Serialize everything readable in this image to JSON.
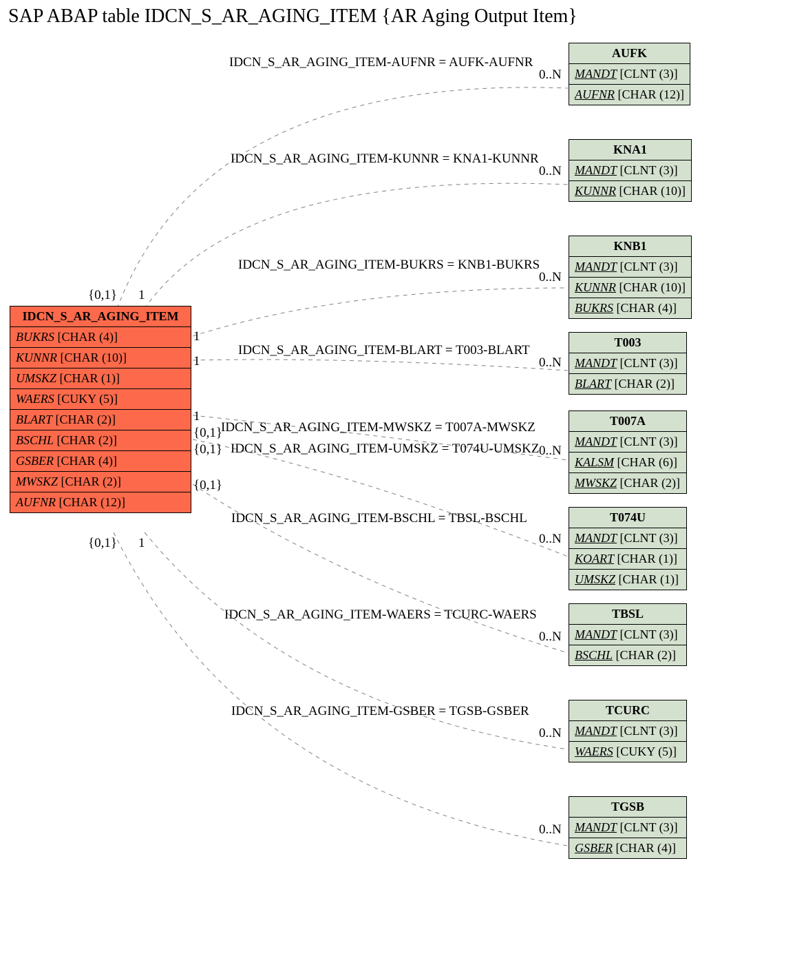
{
  "title": "SAP ABAP table IDCN_S_AR_AGING_ITEM {AR Aging Output Item}",
  "main_entity": {
    "name": "IDCN_S_AR_AGING_ITEM",
    "fields": [
      {
        "name": "BUKRS",
        "type": "[CHAR (4)]"
      },
      {
        "name": "KUNNR",
        "type": "[CHAR (10)]"
      },
      {
        "name": "UMSKZ",
        "type": "[CHAR (1)]"
      },
      {
        "name": "WAERS",
        "type": "[CUKY (5)]"
      },
      {
        "name": "BLART",
        "type": "[CHAR (2)]"
      },
      {
        "name": "BSCHL",
        "type": "[CHAR (2)]"
      },
      {
        "name": "GSBER",
        "type": "[CHAR (4)]"
      },
      {
        "name": "MWSKZ",
        "type": "[CHAR (2)]"
      },
      {
        "name": "AUFNR",
        "type": "[CHAR (12)]"
      }
    ]
  },
  "targets": [
    {
      "name": "AUFK",
      "fields": [
        {
          "name": "MANDT",
          "type": "[CLNT (3)]"
        },
        {
          "name": "AUFNR",
          "type": "[CHAR (12)]"
        }
      ]
    },
    {
      "name": "KNA1",
      "fields": [
        {
          "name": "MANDT",
          "type": "[CLNT (3)]"
        },
        {
          "name": "KUNNR",
          "type": "[CHAR (10)]"
        }
      ]
    },
    {
      "name": "KNB1",
      "fields": [
        {
          "name": "MANDT",
          "type": "[CLNT (3)]"
        },
        {
          "name": "KUNNR",
          "type": "[CHAR (10)]"
        },
        {
          "name": "BUKRS",
          "type": "[CHAR (4)]"
        }
      ]
    },
    {
      "name": "T003",
      "fields": [
        {
          "name": "MANDT",
          "type": "[CLNT (3)]"
        },
        {
          "name": "BLART",
          "type": "[CHAR (2)]"
        }
      ]
    },
    {
      "name": "T007A",
      "fields": [
        {
          "name": "MANDT",
          "type": "[CLNT (3)]"
        },
        {
          "name": "KALSM",
          "type": "[CHAR (6)]"
        },
        {
          "name": "MWSKZ",
          "type": "[CHAR (2)]"
        }
      ]
    },
    {
      "name": "T074U",
      "fields": [
        {
          "name": "MANDT",
          "type": "[CLNT (3)]"
        },
        {
          "name": "KOART",
          "type": "[CHAR (1)]"
        },
        {
          "name": "UMSKZ",
          "type": "[CHAR (1)]"
        }
      ]
    },
    {
      "name": "TBSL",
      "fields": [
        {
          "name": "MANDT",
          "type": "[CLNT (3)]"
        },
        {
          "name": "BSCHL",
          "type": "[CHAR (2)]"
        }
      ]
    },
    {
      "name": "TCURC",
      "fields": [
        {
          "name": "MANDT",
          "type": "[CLNT (3)]"
        },
        {
          "name": "WAERS",
          "type": "[CUKY (5)]"
        }
      ]
    },
    {
      "name": "TGSB",
      "fields": [
        {
          "name": "MANDT",
          "type": "[CLNT (3)]"
        },
        {
          "name": "GSBER",
          "type": "[CHAR (4)]"
        }
      ]
    }
  ],
  "relations": [
    {
      "label": "IDCN_S_AR_AGING_ITEM-AUFNR = AUFK-AUFNR"
    },
    {
      "label": "IDCN_S_AR_AGING_ITEM-KUNNR = KNA1-KUNNR"
    },
    {
      "label": "IDCN_S_AR_AGING_ITEM-BUKRS = KNB1-BUKRS"
    },
    {
      "label": "IDCN_S_AR_AGING_ITEM-BLART = T003-BLART"
    },
    {
      "label": "IDCN_S_AR_AGING_ITEM-MWSKZ = T007A-MWSKZ"
    },
    {
      "label": "IDCN_S_AR_AGING_ITEM-UMSKZ = T074U-UMSKZ"
    },
    {
      "label": "IDCN_S_AR_AGING_ITEM-BSCHL = TBSL-BSCHL"
    },
    {
      "label": "IDCN_S_AR_AGING_ITEM-WAERS = TCURC-WAERS"
    },
    {
      "label": "IDCN_S_AR_AGING_ITEM-GSBER = TGSB-GSBER"
    }
  ],
  "card": {
    "zero_n": "0..N",
    "one": "1",
    "zero_one": "{0,1}"
  }
}
